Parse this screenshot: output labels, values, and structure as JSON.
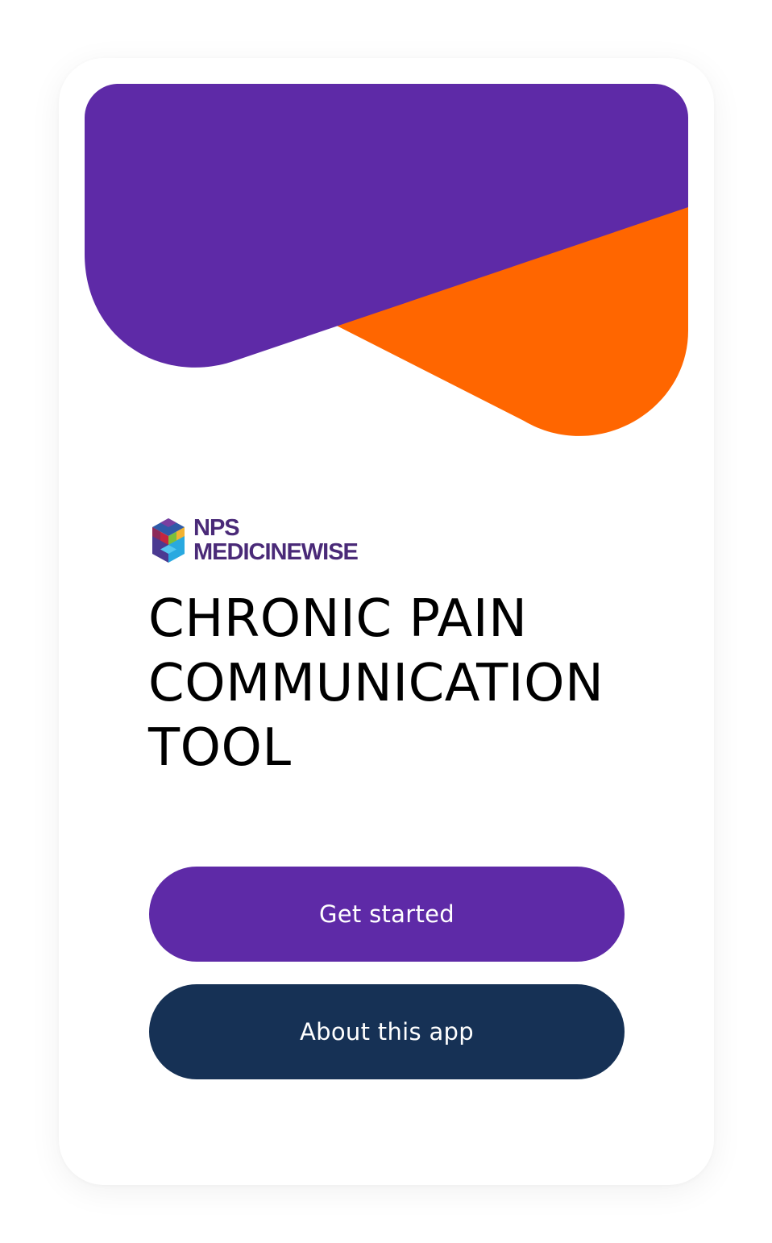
{
  "colors": {
    "purple": "#5e2aa7",
    "orange": "#ff6600",
    "navy": "#163155",
    "logo_text": "#4a2a78",
    "title": "#000000"
  },
  "brand": {
    "line1": "NPS",
    "line2": "MEDICINEWISE",
    "icon": "hexagon-cube-logo-icon"
  },
  "title": {
    "lines": [
      "CHRONIC PAIN",
      "COMMUNICATION",
      "TOOL"
    ]
  },
  "buttons": {
    "get_started": "Get started",
    "about": "About this app"
  }
}
